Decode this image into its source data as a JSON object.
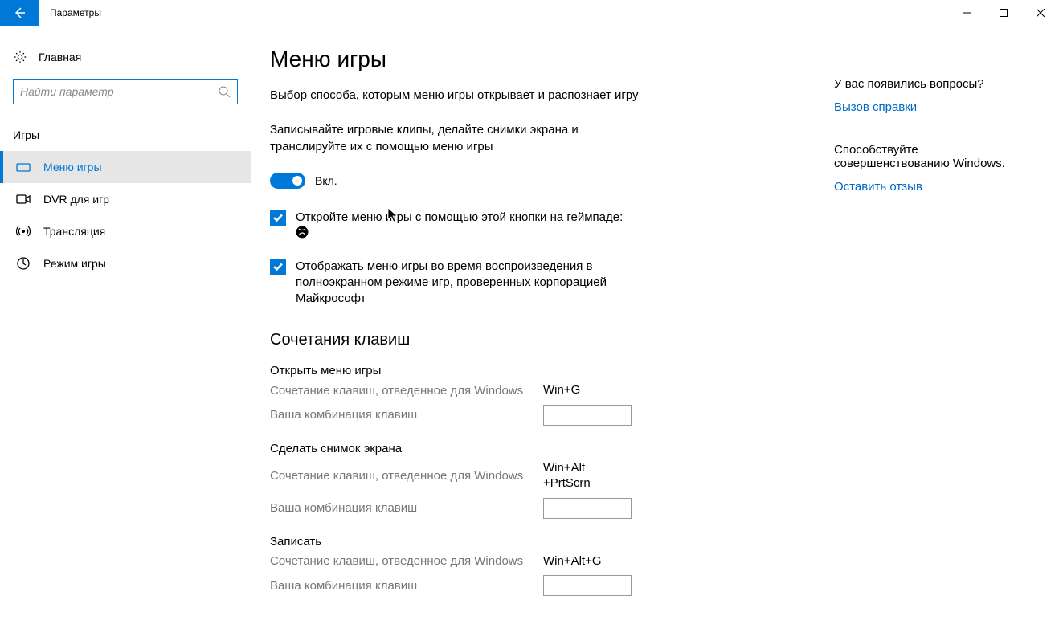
{
  "window": {
    "title": "Параметры"
  },
  "sidebar": {
    "home": "Главная",
    "search_placeholder": "Найти параметр",
    "group": "Игры",
    "items": [
      {
        "label": "Меню игры",
        "icon": "gamebar"
      },
      {
        "label": "DVR для игр",
        "icon": "dvr"
      },
      {
        "label": "Трансляция",
        "icon": "broadcast"
      },
      {
        "label": "Режим игры",
        "icon": "gamemode"
      }
    ]
  },
  "main": {
    "title": "Меню игры",
    "desc1": "Выбор способа, которым меню игры открывает и распознает игру",
    "desc2": "Записывайте игровые клипы, делайте снимки экрана и транслируйте их с помощью меню игры",
    "toggle_label": "Вкл.",
    "check1": "Откройте меню игры с помощью этой кнопки на геймпаде:",
    "check2": "Отображать меню игры во время воспроизведения в полноэкранном режиме игр, проверенных корпорацией Майкрософт",
    "shortcuts_heading": "Сочетания клавиш",
    "win_label": "Сочетание клавиш, отведенное для Windows",
    "user_label": "Ваша комбинация клавиш",
    "groups": [
      {
        "title": "Открыть меню игры",
        "win": "Win+G"
      },
      {
        "title": "Сделать снимок экрана",
        "win": "Win+Alt\n+PrtScrn"
      },
      {
        "title": "Записать",
        "win": "Win+Alt+G"
      }
    ]
  },
  "aside": {
    "q_head": "У вас появились вопросы?",
    "q_link": "Вызов справки",
    "f_head": "Способствуйте совершенствованию Windows.",
    "f_link": "Оставить отзыв"
  }
}
